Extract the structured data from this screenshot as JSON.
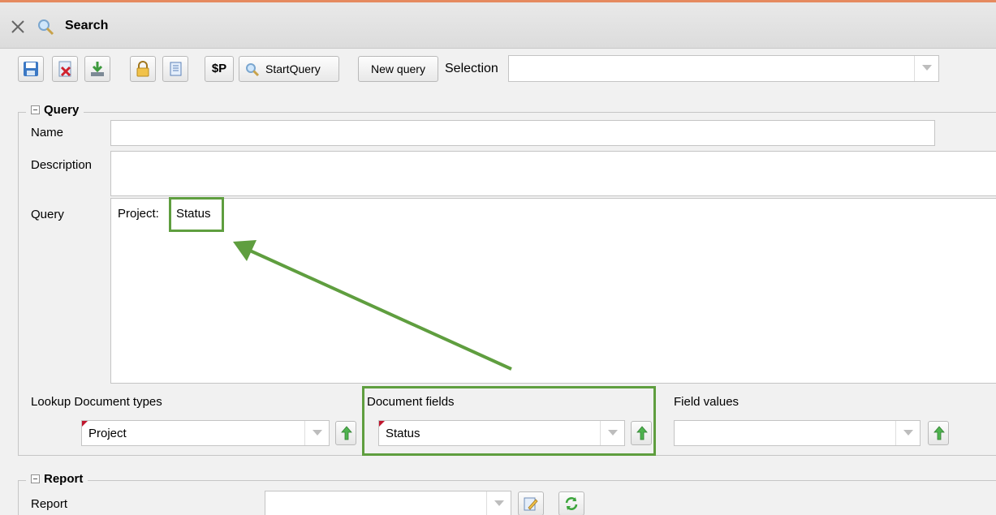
{
  "window": {
    "title": "Search"
  },
  "toolbar": {
    "sp_label": "$P",
    "start_query_label": "StartQuery",
    "new_query_label": "New query",
    "selection_label": "Selection",
    "selection_value": ""
  },
  "query_section": {
    "legend": "Query",
    "name_label": "Name",
    "name_value": "",
    "description_label": "Description",
    "description_value": "",
    "query_label": "Query",
    "query_prefix": "Project:",
    "query_highlight": "Status"
  },
  "lookup": {
    "document_types_label": "Lookup Document types",
    "document_types_value": "Project",
    "document_fields_label": "Document fields",
    "document_fields_value": "Status",
    "field_values_label": "Field values",
    "field_values_value": ""
  },
  "report_section": {
    "legend": "Report",
    "report_label": "Report",
    "report_value": ""
  },
  "colors": {
    "highlight": "#5f9e3f",
    "accent_line": "#e58a5f"
  }
}
